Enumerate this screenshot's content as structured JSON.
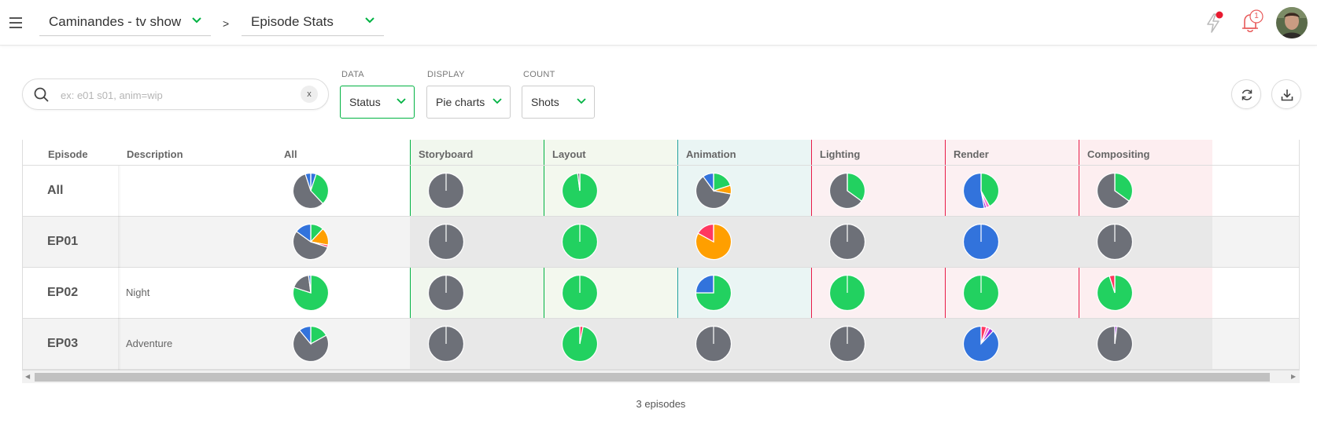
{
  "topbar": {
    "production": "Caminandes - tv show",
    "separator": ">",
    "view": "Episode Stats",
    "notification_count": "1"
  },
  "filters": {
    "search_placeholder": "ex: e01 s01, anim=wip",
    "clear_label": "x",
    "data_label": "DATA",
    "data_value": "Status",
    "display_label": "DISPLAY",
    "display_value": "Pie charts",
    "count_label": "COUNT",
    "count_value": "Shots"
  },
  "table": {
    "col_episode": "Episode",
    "col_description": "Description",
    "col_all": "All",
    "task_columns": [
      {
        "name": "Storyboard",
        "color": "#00b242",
        "bg": "#f1f7ee"
      },
      {
        "name": "Layout",
        "color": "#00b242",
        "bg": "#f3f8ee"
      },
      {
        "name": "Animation",
        "color": "#22a2a0",
        "bg": "#eaf5f4"
      },
      {
        "name": "Lighting",
        "color": "#e81a48",
        "bg": "#fcf0f2"
      },
      {
        "name": "Render",
        "color": "#e81a48",
        "bg": "#fcf0f2"
      },
      {
        "name": "Compositing",
        "color": "#e81a48",
        "bg": "#fdeef0"
      }
    ],
    "rows": [
      {
        "name": "All",
        "description": ""
      },
      {
        "name": "EP01",
        "description": ""
      },
      {
        "name": "EP02",
        "description": "Night"
      },
      {
        "name": "EP03",
        "description": "Adventure"
      }
    ],
    "footer": "3 episodes"
  },
  "status_colors": {
    "todo": "#6d7078",
    "done": "#22d160",
    "wip": "#3273dc",
    "retake": "#ff3860",
    "wfa": "#ff9f00",
    "pink": "#ff6ec7",
    "purple": "#9d2bdb"
  },
  "pies": {
    "rows": [
      [
        [
          [
            "wip",
            0.05
          ],
          [
            "done",
            0.33
          ],
          [
            "todo",
            0.57
          ],
          [
            "wip",
            0.05
          ]
        ],
        [
          [
            "todo",
            1.0
          ]
        ],
        [
          [
            "done",
            0.98
          ],
          [
            "todo",
            0.02
          ]
        ],
        [
          [
            "done",
            0.2
          ],
          [
            "wfa",
            0.08
          ],
          [
            "todo",
            0.62
          ],
          [
            "wip",
            0.1
          ]
        ],
        [
          [
            "done",
            0.35
          ],
          [
            "todo",
            0.65
          ]
        ],
        [
          [
            "done",
            0.42
          ],
          [
            "pink",
            0.03
          ],
          [
            "purple",
            0.02
          ],
          [
            "wip",
            0.53
          ]
        ],
        [
          [
            "done",
            0.35
          ],
          [
            "todo",
            0.65
          ]
        ]
      ],
      [
        [
          [
            "done",
            0.12
          ],
          [
            "wfa",
            0.16
          ],
          [
            "retake",
            0.02
          ],
          [
            "todo",
            0.55
          ],
          [
            "wip",
            0.15
          ]
        ],
        [
          [
            "todo",
            1.0
          ]
        ],
        [
          [
            "done",
            1.0
          ]
        ],
        [
          [
            "wfa",
            0.83
          ],
          [
            "retake",
            0.17
          ]
        ],
        [
          [
            "todo",
            1.0
          ]
        ],
        [
          [
            "wip",
            1.0
          ]
        ],
        [
          [
            "todo",
            1.0
          ]
        ]
      ],
      [
        [
          [
            "done",
            0.8
          ],
          [
            "todo",
            0.18
          ],
          [
            "wip",
            0.02
          ]
        ],
        [
          [
            "todo",
            1.0
          ]
        ],
        [
          [
            "done",
            1.0
          ]
        ],
        [
          [
            "done",
            0.75
          ],
          [
            "wip",
            0.25
          ]
        ],
        [
          [
            "done",
            1.0
          ]
        ],
        [
          [
            "done",
            1.0
          ]
        ],
        [
          [
            "done",
            0.95
          ],
          [
            "retake",
            0.05
          ]
        ]
      ],
      [
        [
          [
            "done",
            0.17
          ],
          [
            "todo",
            0.72
          ],
          [
            "wip",
            0.11
          ]
        ],
        [
          [
            "todo",
            1.0
          ]
        ],
        [
          [
            "retake",
            0.03
          ],
          [
            "done",
            0.97
          ]
        ],
        [
          [
            "todo",
            1.0
          ]
        ],
        [
          [
            "todo",
            1.0
          ]
        ],
        [
          [
            "retake",
            0.05
          ],
          [
            "pink",
            0.03
          ],
          [
            "purple",
            0.04
          ],
          [
            "wip",
            0.88
          ]
        ],
        [
          [
            "purple",
            0.02
          ],
          [
            "todo",
            0.98
          ]
        ]
      ]
    ]
  }
}
